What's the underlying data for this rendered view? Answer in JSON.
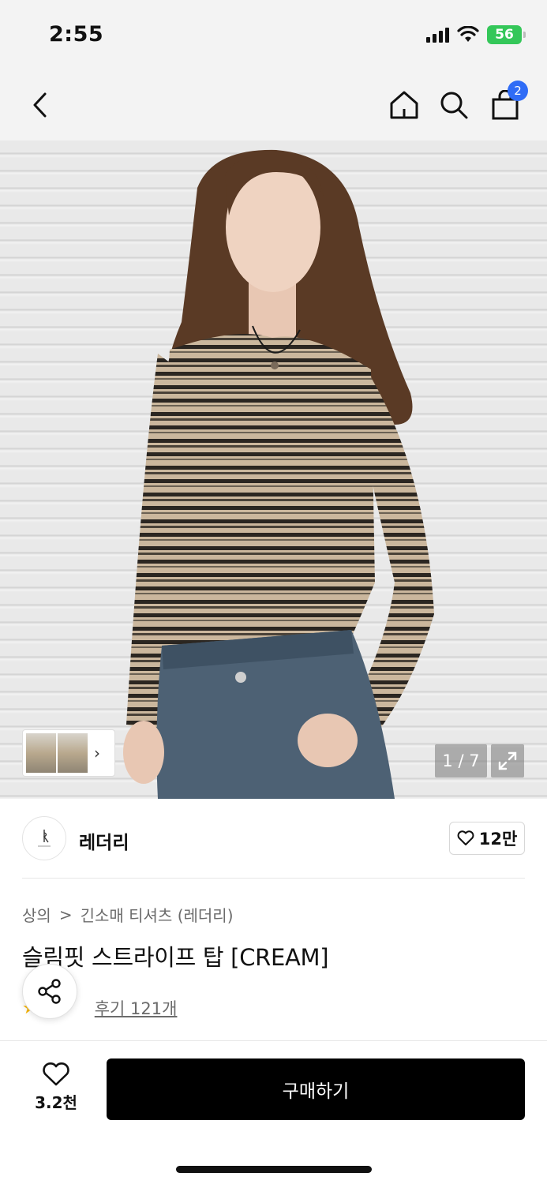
{
  "status_bar": {
    "time": "2:55",
    "battery": "56"
  },
  "nav": {
    "back_icon": "chevron-left-icon",
    "home_icon": "home-icon",
    "search_icon": "search-icon",
    "cart_icon": "shopping-bag-icon",
    "cart_count": "2",
    "badge_color": "#2f6cf6"
  },
  "gallery": {
    "page_indicator": "1 / 7",
    "thumbnail_arrow": "›",
    "expand_icon": "expand-icon",
    "current_image": 1,
    "total_images": 7
  },
  "brand": {
    "name": "레더리",
    "likes": "12만",
    "like_icon": "heart-outline-icon"
  },
  "breadcrumb": {
    "items": [
      "상의",
      "긴소매 티셔츠 (레더리)"
    ],
    "separator": ">"
  },
  "product": {
    "title": "슬림핏 스트라이프 탑 [CREAM]",
    "review_label": "후기 121개",
    "star_color": "#f7b500"
  },
  "bottom_bar": {
    "wish_count": "3.2천",
    "buy_label": "구매하기",
    "buy_color": "#000000"
  }
}
